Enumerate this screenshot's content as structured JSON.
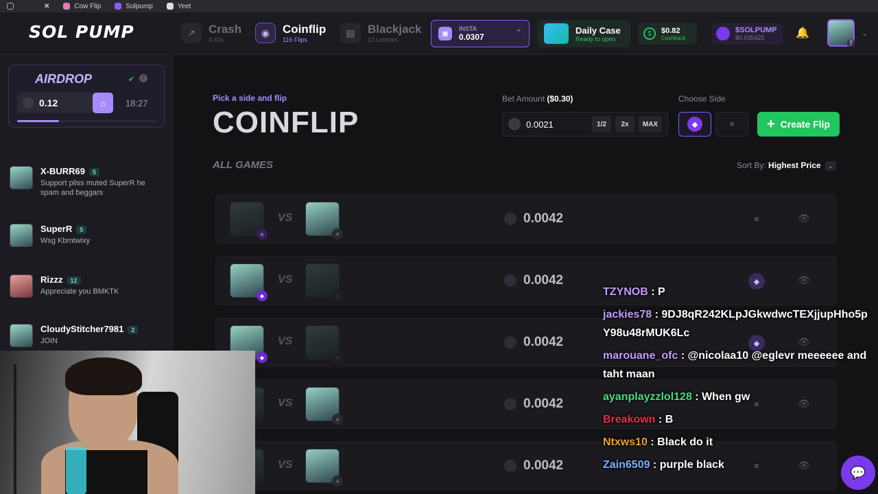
{
  "browser": {
    "bookmarks": [
      {
        "label": "",
        "icon": "grid-icon"
      },
      {
        "label": "",
        "icon": "x-icon"
      },
      {
        "label": "Cow Flip",
        "icon": "cow-icon"
      },
      {
        "label": "Solpump",
        "icon": "pump-icon"
      },
      {
        "label": "Yeet",
        "icon": "yeet-icon"
      }
    ]
  },
  "nav": {
    "logo": "SOL PUMP",
    "items": [
      {
        "title": "Crash",
        "sub": "2.42x",
        "icon": "chart-up-icon"
      },
      {
        "title": "Coinflip",
        "sub": "116 Flips",
        "icon": "coin-icon",
        "active": true
      },
      {
        "title": "Blackjack",
        "sub": "13 Lobbies",
        "icon": "cards-icon"
      }
    ],
    "insta": {
      "label": "INSTA",
      "value": "0.0307"
    },
    "daily": {
      "title": "Daily Case",
      "status": "Ready to open"
    },
    "cashback": {
      "value": "$0.82",
      "label": "Cashback"
    },
    "solpump": {
      "label": "$SOLPUMP",
      "value": "$0.035425"
    },
    "user_level": "7"
  },
  "airdrop": {
    "title": "AIRDROP",
    "amount": "0.12",
    "timer": "18:27",
    "progress": 0.3
  },
  "chat": [
    {
      "user": "X-BURR69",
      "level": "5",
      "text": "Support pliss muted SuperR he spam and beggars"
    },
    {
      "user": "SuperR",
      "level": "5",
      "text": "Wsg Kbmtwixy"
    },
    {
      "user": "Rizzz",
      "level": "12",
      "text": "Appreciate you BMKTK"
    },
    {
      "user": "CloudyStitcher7981",
      "level": "2",
      "text": "JOIN"
    }
  ],
  "main": {
    "pick": "Pick a side and flip",
    "title": "COINFLIP",
    "bet_label": "Bet Amount",
    "bet_usd": "($0.30)",
    "bet_value": "0.0021",
    "half": "1/2",
    "double": "2x",
    "max": "MAX",
    "choose_side": "Choose Side",
    "create": "Create Flip",
    "all_games": "ALL GAMES",
    "sort_label": "Sort By:",
    "sort_value": "Highest Price"
  },
  "games": [
    {
      "value": "0.0042",
      "side": "black"
    },
    {
      "value": "0.0042",
      "side": "purple"
    },
    {
      "value": "0.0042",
      "side": "purple"
    },
    {
      "value": "0.0042",
      "side": "black"
    },
    {
      "value": "0.0042",
      "side": "black"
    }
  ],
  "stream_chat": [
    {
      "user": "TZYNOB",
      "color": "#c89bff",
      "text": "P"
    },
    {
      "user": "jackies78",
      "color": "#c89bff",
      "text": "9DJ8qR242KLpJGkwdwcTEXjjupHho5pY98u48rMUK6Lc"
    },
    {
      "user": "marouane_ofc",
      "color": "#c89bff",
      "text": "@nicolaa10 @eglevr meeeeee and taht maan"
    },
    {
      "user": "ayanplayzzlol128",
      "color": "#4ade80",
      "text": "When gw"
    },
    {
      "user": "Breakown",
      "color": "#ef2a4a",
      "text": "B"
    },
    {
      "user": "Ntxws10",
      "color": "#f0a020",
      "text": "Black do it"
    },
    {
      "user": "Zain6509",
      "color": "#7cb3ff",
      "text": "purple black"
    }
  ],
  "colors": {
    "accent": "#8b5cf6",
    "green": "#22c55e",
    "bg": "#131316"
  }
}
